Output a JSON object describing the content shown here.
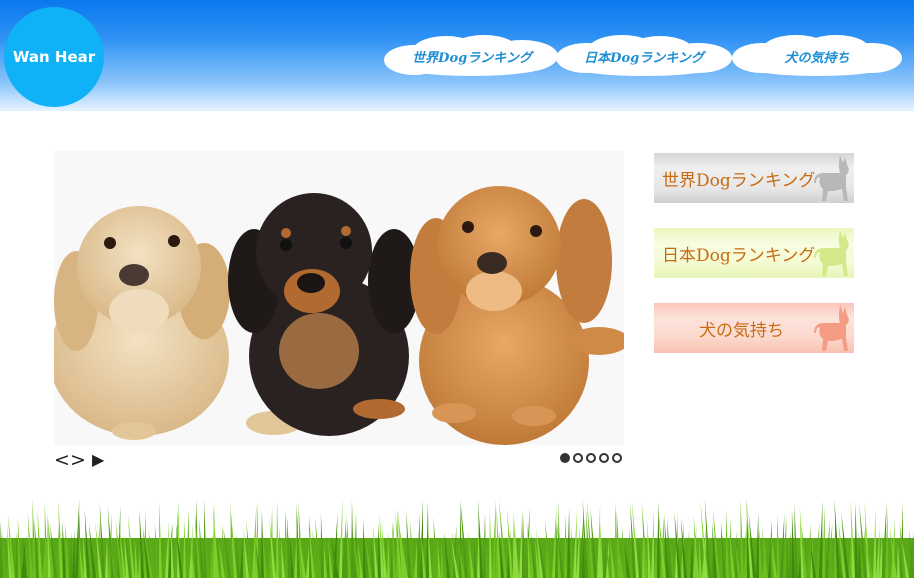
{
  "site": {
    "logo_text": "Wan Hear"
  },
  "nav": [
    {
      "label": "世界Dogランキング"
    },
    {
      "label": "日本Dogランキング"
    },
    {
      "label": "犬の気持ち"
    }
  ],
  "slider": {
    "image_alt": "three dachshunds",
    "controls": {
      "prev": "<",
      "next": ">",
      "play": "▶"
    },
    "dot_count": 5,
    "active_index": 0
  },
  "banners": [
    {
      "label": "世界Dogランキング",
      "color": "#c86a10"
    },
    {
      "label": "日本Dogランキング",
      "color": "#c86a10"
    },
    {
      "label": "犬の気持ち",
      "color": "#c86a10"
    }
  ],
  "colors": {
    "header_top": "#0a78ee",
    "logo": "#10b2f7",
    "nav_text": "#1f8fd3",
    "grass": "#6bbf1e"
  }
}
